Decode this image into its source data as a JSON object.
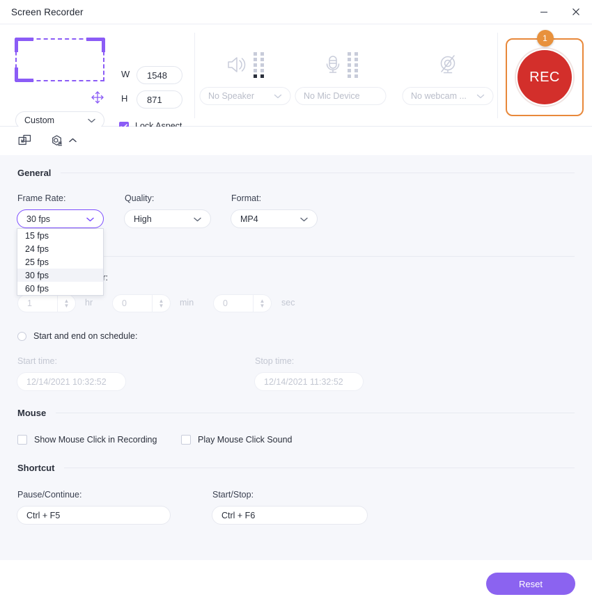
{
  "window": {
    "title": "Screen Recorder",
    "minimize_icon": "minimize-icon",
    "close_icon": "close-icon"
  },
  "capture": {
    "region_icon": "capture-region-icon",
    "move_icon": "move-handle-icon",
    "w_label": "W",
    "h_label": "H",
    "width_value": "1548",
    "height_value": "871",
    "preset_value": "Custom",
    "lock_aspect_label": "Lock Aspect Ratio",
    "lock_aspect_checked": true
  },
  "devices": {
    "speaker": {
      "icon": "speaker-icon",
      "value": "No Speaker"
    },
    "mic": {
      "icon": "microphone-icon",
      "value": "No Mic Device"
    },
    "webcam": {
      "icon": "webcam-disabled-icon",
      "value": "No webcam ..."
    }
  },
  "rec": {
    "label": "REC",
    "badge": "1",
    "border_color": "#e8883a",
    "circle_color": "#d32f2b",
    "badge_color": "#e8913c"
  },
  "toolbar": {
    "items": [
      {
        "icon": "screen-capture-icon",
        "name": "screen-capture-tool"
      },
      {
        "icon": "settings-gear-icon",
        "name": "settings-tool"
      }
    ],
    "caret": "▲"
  },
  "general": {
    "section_title": "General",
    "frame_rate_label": "Frame Rate:",
    "frame_rate_value": "30 fps",
    "frame_rate_options": [
      "15 fps",
      "24 fps",
      "25 fps",
      "30 fps",
      "60 fps"
    ],
    "frame_rate_selected": "30 fps",
    "quality_label": "Quality:",
    "quality_value": "High",
    "format_label": "Format:",
    "format_value": "MP4"
  },
  "duration": {
    "after_radio_label": "Start and end after:",
    "hr_value": "1",
    "hr_unit": "hr",
    "min_value": "0",
    "min_unit": "min",
    "sec_value": "0",
    "sec_unit": "sec",
    "schedule_radio_label": "Start and end on schedule:",
    "start_time_label": "Start time:",
    "start_time_value": "12/14/2021 10:32:52",
    "stop_time_label": "Stop time:",
    "stop_time_value": "12/14/2021 11:32:52"
  },
  "mouse": {
    "section_title": "Mouse",
    "show_click_label": "Show Mouse Click in Recording",
    "show_click_checked": false,
    "play_sound_label": "Play Mouse Click Sound",
    "play_sound_checked": false
  },
  "shortcut": {
    "section_title": "Shortcut",
    "pause_label": "Pause/Continue:",
    "pause_value": "Ctrl + F5",
    "start_label": "Start/Stop:",
    "start_value": "Ctrl + F6"
  },
  "footer": {
    "reset_label": "Reset",
    "reset_color": "#8b63f0"
  }
}
